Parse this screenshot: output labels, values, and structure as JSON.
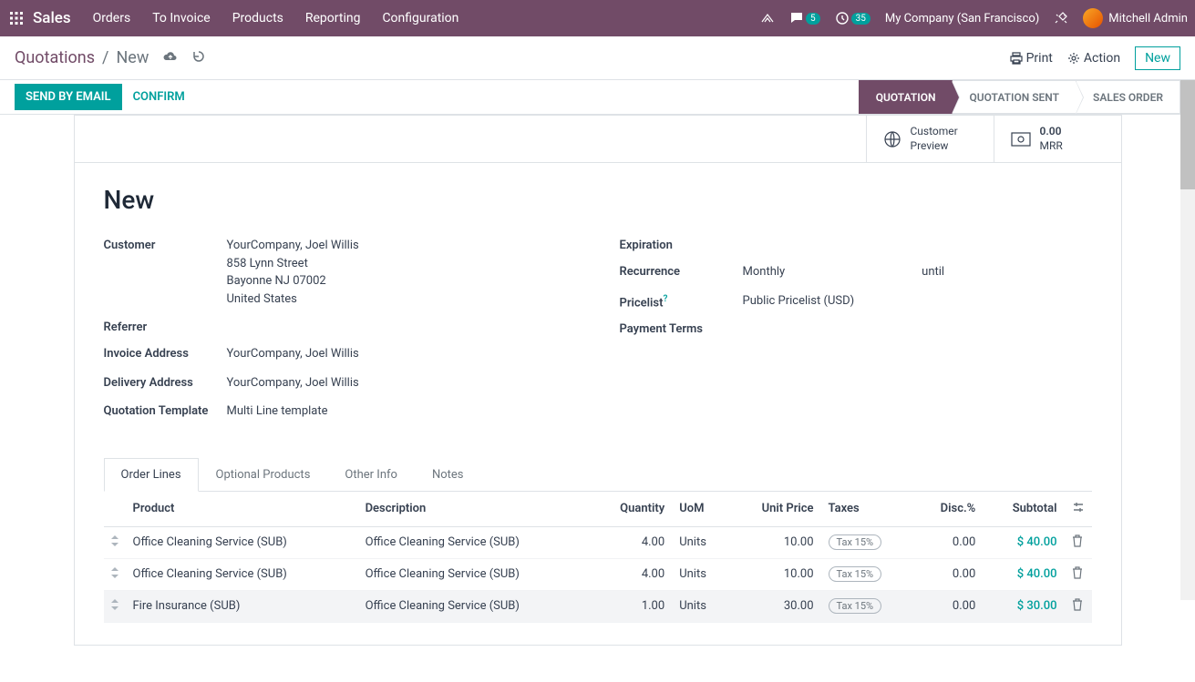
{
  "nav": {
    "brand": "Sales",
    "items": [
      "Orders",
      "To Invoice",
      "Products",
      "Reporting",
      "Configuration"
    ],
    "chat_badge": "5",
    "clock_badge": "35",
    "company": "My Company (San Francisco)",
    "user": "Mitchell Admin"
  },
  "breadcrumb": {
    "root": "Quotations",
    "current": "New",
    "print": "Print",
    "action": "Action",
    "new": "New"
  },
  "buttons": {
    "send_email": "SEND BY EMAIL",
    "confirm": "CONFIRM"
  },
  "stages": [
    "QUOTATION",
    "QUOTATION SENT",
    "SALES ORDER"
  ],
  "stats": {
    "preview_l1": "Customer",
    "preview_l2": "Preview",
    "mrr_val": "0.00",
    "mrr_label": "MRR"
  },
  "title": "New",
  "fields": {
    "customer_label": "Customer",
    "customer_name": "YourCompany, Joel Willis",
    "customer_street": "858 Lynn Street",
    "customer_city": "Bayonne NJ 07002",
    "customer_country": "United States",
    "referrer_label": "Referrer",
    "invoice_addr_label": "Invoice Address",
    "invoice_addr": "YourCompany, Joel Willis",
    "delivery_addr_label": "Delivery Address",
    "delivery_addr": "YourCompany, Joel Willis",
    "template_label": "Quotation Template",
    "template": "Multi Line template",
    "expiration_label": "Expiration",
    "recurrence_label": "Recurrence",
    "recurrence_val": "Monthly",
    "recurrence_until": "until",
    "pricelist_label": "Pricelist",
    "pricelist_val": "Public Pricelist (USD)",
    "payment_terms_label": "Payment Terms"
  },
  "tabs": [
    "Order Lines",
    "Optional Products",
    "Other Info",
    "Notes"
  ],
  "table": {
    "headers": {
      "product": "Product",
      "description": "Description",
      "quantity": "Quantity",
      "uom": "UoM",
      "unit_price": "Unit Price",
      "taxes": "Taxes",
      "disc": "Disc.%",
      "subtotal": "Subtotal"
    },
    "rows": [
      {
        "product": "Office Cleaning Service (SUB)",
        "description": "Office Cleaning Service (SUB)",
        "qty": "4.00",
        "uom": "Units",
        "price": "10.00",
        "tax": "Tax 15%",
        "disc": "0.00",
        "subtotal": "$ 40.00"
      },
      {
        "product": "Office Cleaning Service (SUB)",
        "description": "Office Cleaning Service (SUB)",
        "qty": "4.00",
        "uom": "Units",
        "price": "10.00",
        "tax": "Tax 15%",
        "disc": "0.00",
        "subtotal": "$ 40.00"
      },
      {
        "product": "Fire Insurance (SUB)",
        "description": "Office Cleaning Service (SUB)",
        "qty": "1.00",
        "uom": "Units",
        "price": "30.00",
        "tax": "Tax 15%",
        "disc": "0.00",
        "subtotal": "$ 30.00"
      }
    ]
  }
}
